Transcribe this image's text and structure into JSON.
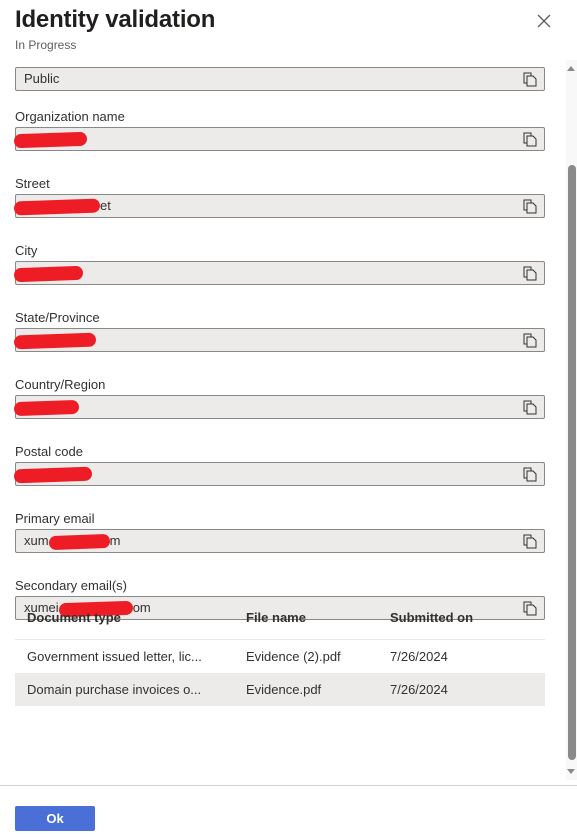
{
  "header": {
    "title": "Identity validation",
    "status": "In Progress"
  },
  "fields": [
    {
      "label": "",
      "value_prefix": "Public",
      "redacted": false,
      "value_suffix": ""
    },
    {
      "label": "Organization name",
      "value_prefix": "",
      "redacted": true,
      "value_suffix": ""
    },
    {
      "label": "Street",
      "value_prefix": "",
      "redacted": true,
      "value_suffix": "et"
    },
    {
      "label": "City",
      "value_prefix": "",
      "redacted": true,
      "value_suffix": ""
    },
    {
      "label": "State/Province",
      "value_prefix": "",
      "redacted": true,
      "value_suffix": ""
    },
    {
      "label": "Country/Region",
      "value_prefix": "",
      "redacted": true,
      "value_suffix": ""
    },
    {
      "label": "Postal code",
      "value_prefix": "",
      "redacted": true,
      "value_suffix": ""
    },
    {
      "label": "Primary email",
      "value_prefix": "xum",
      "redacted": true,
      "value_suffix": "m"
    },
    {
      "label": "Secondary email(s)",
      "value_prefix": "xumei",
      "redacted": true,
      "value_suffix": "om"
    }
  ],
  "documents": {
    "headers": [
      "Document type",
      "File name",
      "Submitted on"
    ],
    "rows": [
      [
        "Government issued letter, lic...",
        "Evidence (2).pdf",
        "7/26/2024"
      ],
      [
        "Domain purchase invoices o...",
        "Evidence.pdf",
        "7/26/2024"
      ]
    ]
  },
  "footer": {
    "ok_label": "Ok"
  },
  "colors": {
    "primary": "#4a6fd6",
    "field_bg": "#edebe9",
    "redaction": "#ee1c25"
  }
}
